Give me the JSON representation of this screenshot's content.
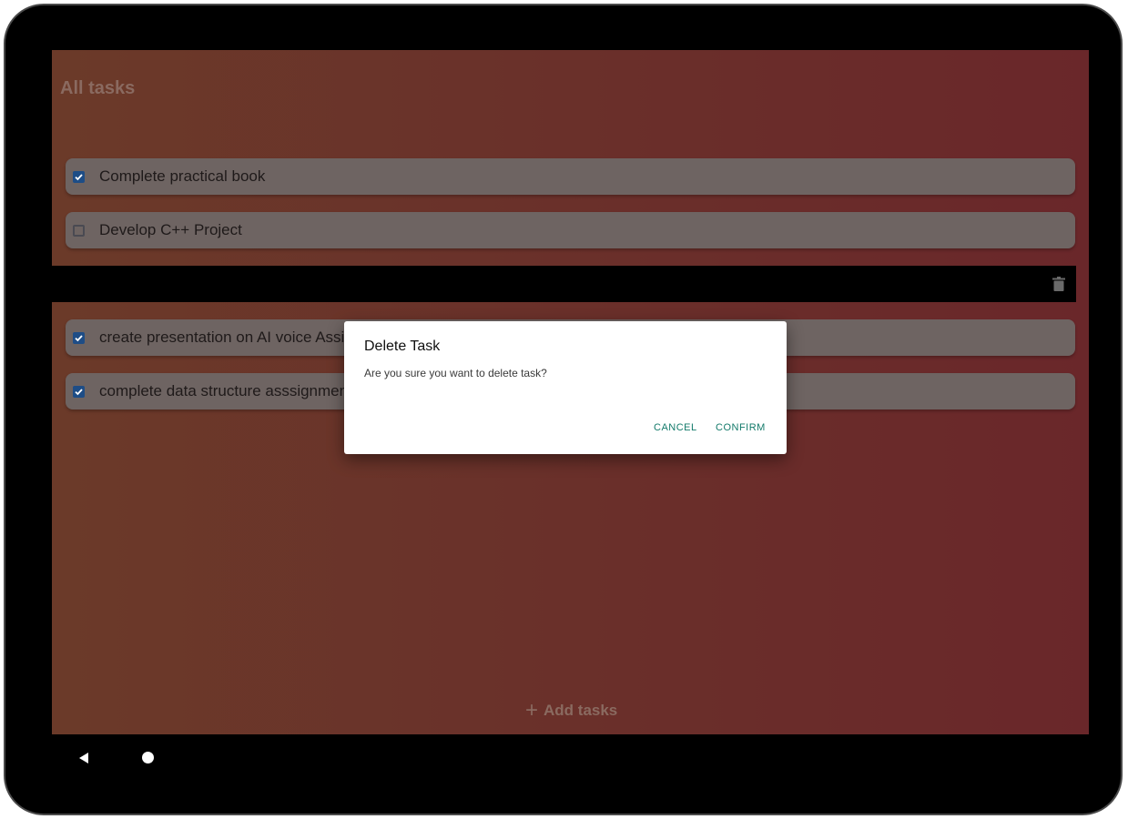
{
  "header": {
    "title": "All tasks"
  },
  "tasks_top": [
    {
      "label": "Complete practical book",
      "checked": true
    },
    {
      "label": "Develop C++ Project",
      "checked": false
    }
  ],
  "tasks_bottom": [
    {
      "label": "create presentation on AI voice Assistant",
      "checked": true
    },
    {
      "label": "complete data structure asssignment",
      "checked": true
    }
  ],
  "swipe": {
    "icon": "trash-icon"
  },
  "footer": {
    "add_label": "Add tasks",
    "add_icon": "plus-icon"
  },
  "dialog": {
    "title": "Delete Task",
    "message": "Are you sure you want to delete task?",
    "cancel_label": "CANCEL",
    "confirm_label": "CONFIRM"
  },
  "nav": {
    "back_icon": "back-icon",
    "home_icon": "home-icon"
  },
  "colors": {
    "accent": "#137a6a",
    "checkbox": "#1e4d86",
    "background_left": "#6b3a29",
    "background_right": "#6a272a"
  }
}
